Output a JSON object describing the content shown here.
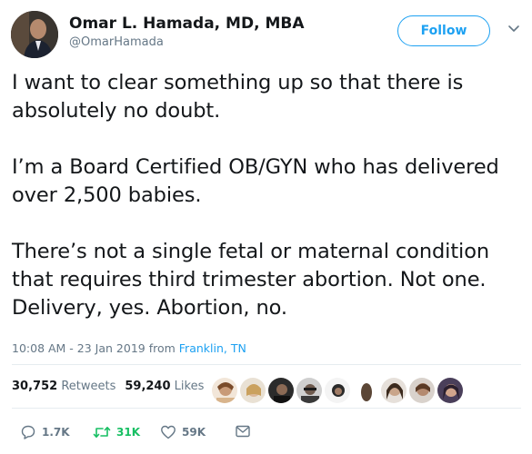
{
  "header": {
    "name": "Omar L. Hamada, MD, MBA",
    "handle": "@OmarHamada",
    "follow_label": "Follow",
    "avatar_icon": "profile-photo",
    "menu_icon": "chevron-down-icon"
  },
  "tweet": {
    "paragraphs": [
      "I want to clear something up so that there is absolutely no doubt.",
      "I’m a Board Certified OB/GYN who has delivered over 2,500 babies.",
      "There’s not a single fetal or maternal condition that requires third trimester abortion. Not one. Delivery, yes. Abortion, no."
    ],
    "timestamp": "10:08 AM - 23 Jan 2019 from",
    "location": "Franklin, TN"
  },
  "stats": {
    "retweets_count": "30,752",
    "retweets_label": "Retweets",
    "likes_count": "59,240",
    "likes_label": "Likes"
  },
  "actions": {
    "reply_count": "1.7K",
    "retweet_count": "31K",
    "like_count": "59K"
  },
  "colors": {
    "accent": "#1da1f2",
    "retweet_green": "#17bf63",
    "muted": "#657786"
  }
}
